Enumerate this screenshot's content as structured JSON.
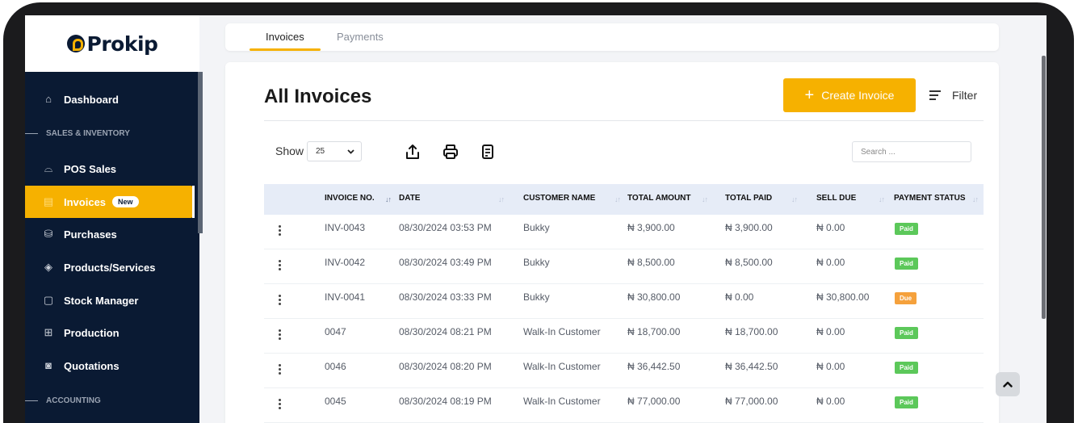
{
  "brand": {
    "logo_text": "Prokip"
  },
  "sidebar": {
    "items": [
      {
        "label": "Dashboard",
        "icon": "home-icon"
      },
      {
        "label": "POS Sales",
        "icon": "shopping-bag-icon"
      },
      {
        "label": "Invoices",
        "icon": "invoice-icon",
        "badge": "New",
        "active": true
      },
      {
        "label": "Purchases",
        "icon": "purchases-icon"
      },
      {
        "label": "Products/Services",
        "icon": "box-icon"
      },
      {
        "label": "Stock Manager",
        "icon": "stock-icon"
      },
      {
        "label": "Production",
        "icon": "production-icon"
      },
      {
        "label": "Quotations",
        "icon": "quotation-icon"
      }
    ],
    "sections": [
      "SALES & INVENTORY",
      "ACCOUNTING"
    ]
  },
  "tabs": [
    {
      "label": "Invoices",
      "active": true
    },
    {
      "label": "Payments",
      "active": false
    }
  ],
  "main": {
    "title": "All Invoices",
    "create_label": "Create Invoice",
    "filter_label": "Filter",
    "show_label": "Show",
    "page_size": "25",
    "search_placeholder": "Search ..."
  },
  "table": {
    "columns": [
      "INVOICE NO.",
      "DATE",
      "CUSTOMER NAME",
      "TOTAL AMOUNT",
      "TOTAL PAID",
      "SELL DUE",
      "PAYMENT STATUS"
    ],
    "rows": [
      {
        "invoice_no": "INV-0043",
        "date": "08/30/2024 03:53 PM",
        "customer": "Bukky",
        "total_amount": "₦ 3,900.00",
        "total_paid": "₦ 3,900.00",
        "sell_due": "₦ 0.00",
        "status": "Paid"
      },
      {
        "invoice_no": "INV-0042",
        "date": "08/30/2024 03:49 PM",
        "customer": "Bukky",
        "total_amount": "₦ 8,500.00",
        "total_paid": "₦ 8,500.00",
        "sell_due": "₦ 0.00",
        "status": "Paid"
      },
      {
        "invoice_no": "INV-0041",
        "date": "08/30/2024 03:33 PM",
        "customer": "Bukky",
        "total_amount": "₦ 30,800.00",
        "total_paid": "₦ 0.00",
        "sell_due": "₦ 30,800.00",
        "status": "Due"
      },
      {
        "invoice_no": "0047",
        "date": "08/30/2024 08:21 PM",
        "customer": "Walk-In Customer",
        "total_amount": "₦ 18,700.00",
        "total_paid": "₦ 18,700.00",
        "sell_due": "₦ 0.00",
        "status": "Paid"
      },
      {
        "invoice_no": "0046",
        "date": "08/30/2024 08:20 PM",
        "customer": "Walk-In Customer",
        "total_amount": "₦ 36,442.50",
        "total_paid": "₦ 36,442.50",
        "sell_due": "₦ 0.00",
        "status": "Paid"
      },
      {
        "invoice_no": "0045",
        "date": "08/30/2024 08:19 PM",
        "customer": "Walk-In Customer",
        "total_amount": "₦ 77,000.00",
        "total_paid": "₦ 77,000.00",
        "sell_due": "₦ 0.00",
        "status": "Paid"
      }
    ]
  },
  "colors": {
    "accent": "#f6b100",
    "sidebar_bg": "#0a1a33",
    "status_paid": "#5cc85a",
    "status_due": "#f5a13c",
    "table_header_bg": "#e6ecf7"
  }
}
